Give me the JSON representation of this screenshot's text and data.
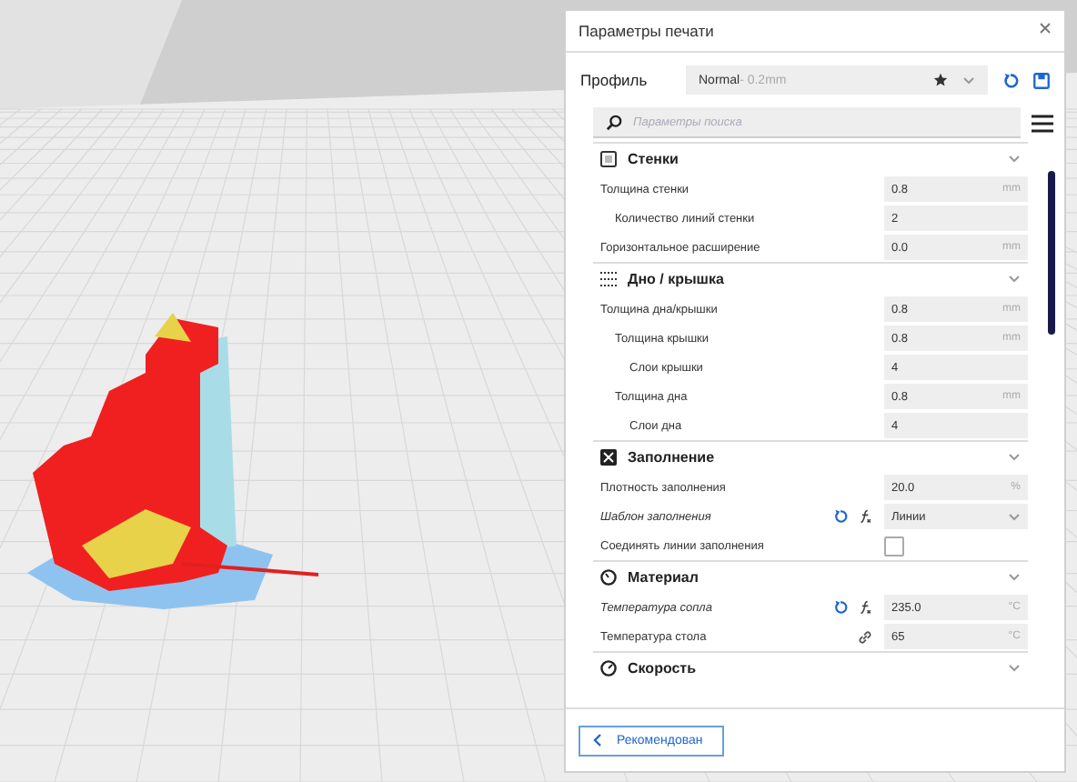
{
  "window": {
    "title": "Параметры печати"
  },
  "profile": {
    "label": "Профиль",
    "name": "Normal",
    "suffix": " - 0.2mm"
  },
  "search": {
    "placeholder": "Параметры поиска"
  },
  "sections": [
    {
      "title": "Стенки",
      "kind": "walls",
      "settings": [
        {
          "label": "Толщина стенки",
          "kind": "number",
          "value": "0.8",
          "unit": "mm",
          "modified": false,
          "linked": false,
          "children": [
            {
              "label": "Количество линий стенки",
              "kind": "number",
              "value": "2",
              "modified": false,
              "linked": false
            }
          ]
        },
        {
          "label": "Горизонтальное расширение",
          "kind": "number",
          "value": "0.0",
          "unit": "mm",
          "modified": false,
          "linked": false
        }
      ]
    },
    {
      "title": "Дно / крышка",
      "kind": "topbottom",
      "settings": [
        {
          "label": "Толщина дна/крышки",
          "kind": "number",
          "value": "0.8",
          "unit": "mm",
          "modified": false,
          "linked": false,
          "children": [
            {
              "label": "Толщина крышки",
              "kind": "number",
              "value": "0.8",
              "unit": "mm",
              "modified": false,
              "linked": false,
              "children": [
                {
                  "label": "Слои крышки",
                  "kind": "number",
                  "value": "4",
                  "modified": false,
                  "linked": false
                }
              ]
            },
            {
              "label": "Толщина дна",
              "kind": "number",
              "value": "0.8",
              "unit": "mm",
              "modified": false,
              "linked": false,
              "children": [
                {
                  "label": "Слои дна",
                  "kind": "number",
                  "value": "4",
                  "modified": false,
                  "linked": false
                }
              ]
            }
          ]
        }
      ]
    },
    {
      "title": "Заполнение",
      "kind": "infill",
      "settings": [
        {
          "label": "Плотность заполнения",
          "kind": "number",
          "value": "20.0",
          "unit": "%",
          "modified": false,
          "linked": false
        },
        {
          "label": "Шаблон заполнения",
          "kind": "select",
          "value": "Линии",
          "modified": true,
          "linked": false
        },
        {
          "label": "Соединять линии заполнения",
          "kind": "checkbox",
          "checked": false,
          "modified": false,
          "linked": false
        }
      ]
    },
    {
      "title": "Материал",
      "kind": "material",
      "settings": [
        {
          "label": "Температура сопла",
          "kind": "number",
          "value": "235.0",
          "unit": "°C",
          "modified": true,
          "linked": false
        },
        {
          "label": "Температура стола",
          "kind": "number",
          "value": "65",
          "unit": "°C",
          "modified": false,
          "linked": true
        }
      ]
    },
    {
      "title": "Скорость",
      "kind": "speed"
    }
  ],
  "footer": {
    "button": "Рекомендован"
  }
}
